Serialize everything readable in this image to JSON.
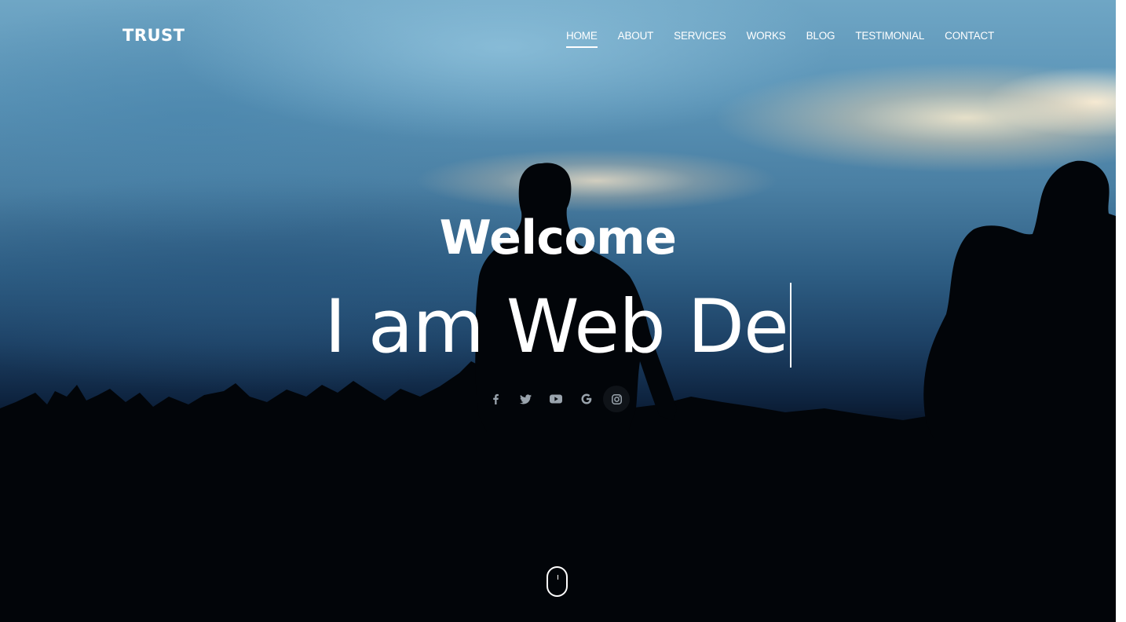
{
  "brand": {
    "logo_text": "TRUST"
  },
  "nav": {
    "items": [
      {
        "label": "HOME",
        "active": true
      },
      {
        "label": "ABOUT",
        "active": false
      },
      {
        "label": "SERVICES",
        "active": false
      },
      {
        "label": "WORKS",
        "active": false
      },
      {
        "label": "BLOG",
        "active": false
      },
      {
        "label": "TESTIMONIAL",
        "active": false
      },
      {
        "label": "CONTACT",
        "active": false
      }
    ]
  },
  "hero": {
    "welcome": "Welcome",
    "typed_text": "I am Web De"
  },
  "social": {
    "icons": [
      "facebook-icon",
      "twitter-icon",
      "youtube-icon",
      "google-icon",
      "instagram-icon"
    ]
  },
  "scroll": {
    "icon": "mouse-scroll-icon"
  },
  "colors": {
    "text": "#ffffff",
    "social_icon": "#9aa4ad"
  }
}
